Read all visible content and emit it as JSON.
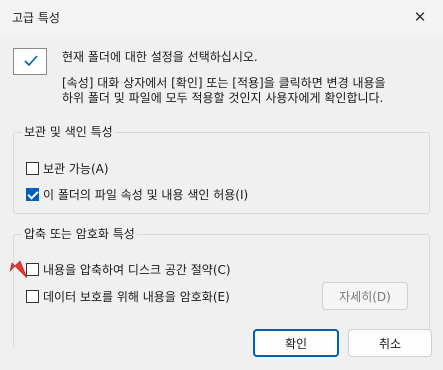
{
  "window": {
    "title": "고급 특성",
    "close_glyph": "✕"
  },
  "intro": {
    "line1": "현재 폴더에 대한 설정을 선택하십시오.",
    "line2": "[속성] 대화 상자에서 [확인] 또는 [적용]을 클릭하면 변경 내용을",
    "line3": "하위 폴더 및 파일에 모두 적용할 것인지 사용자에게 확인합니다."
  },
  "archive_group": {
    "label": "보관 및 색인 특성",
    "archive_ready": {
      "label": "보관 가능(A)",
      "checked": false
    },
    "index_content": {
      "label": "이 폴더의 파일 속성 및 내용 색인 허용(I)",
      "checked": true
    }
  },
  "compress_group": {
    "label": "압축 또는 암호화 특성",
    "compress": {
      "label": "내용을 압축하여 디스크 공간 절약(C)",
      "checked": false
    },
    "encrypt": {
      "label": "데이터 보호를 위해 내용을 암호화(E)",
      "checked": false
    },
    "details_button": "자세히(D)"
  },
  "buttons": {
    "ok": "확인",
    "cancel": "취소"
  },
  "colors": {
    "accent": "#005fb8",
    "annotation_arrow": "#e53935"
  }
}
